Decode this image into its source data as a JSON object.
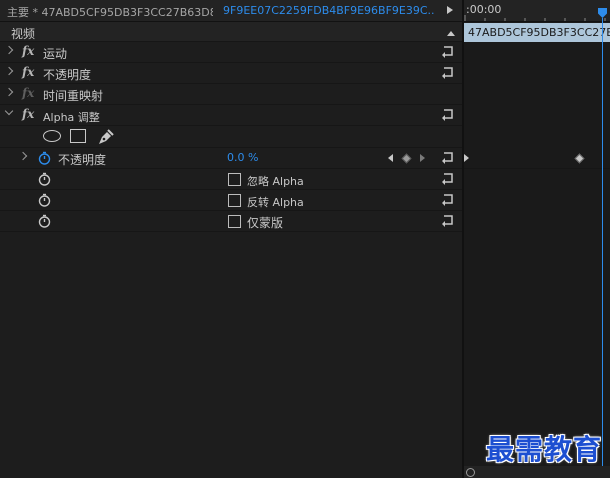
{
  "tabs": {
    "master": "主要 * 47ABD5CF95DB3F3CC27B63D8...",
    "clip": "9F9EE07C2259FDB4BF9E96BF9E39C..."
  },
  "section": {
    "label": "视频"
  },
  "effects": {
    "motion": "运动",
    "opacity": "不透明度",
    "time_remap": "时间重映射",
    "alpha_adjust": "Alpha 调整",
    "fx_symbol": "fx"
  },
  "alpha_params": {
    "opacity_label": "不透明度",
    "opacity_value": "0.0 %",
    "ignore_alpha": "忽略 Alpha",
    "invert_alpha": "反转 Alpha",
    "mask_only": "仅蒙版"
  },
  "timeline": {
    "time_label": ":00:00",
    "clip_label": "47ABD5CF95DB3F3CC27B63"
  },
  "watermark": "最需教育",
  "colors": {
    "accent": "#2d8ceb",
    "clip_bar": "#adc6da",
    "watermark": "#1d4fd1"
  },
  "icons": [
    "reset-icon",
    "stopwatch-icon",
    "ellipse-mask-icon",
    "rectangle-mask-icon",
    "pen-mask-icon",
    "keyframe-icon"
  ]
}
